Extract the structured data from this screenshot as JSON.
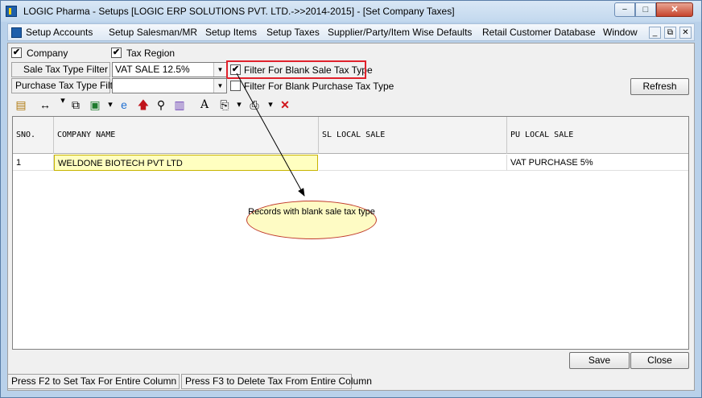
{
  "window": {
    "title": "LOGIC Pharma - Setups  [LOGIC ERP SOLUTIONS PVT. LTD.->>2014-2015] - [Set Company Taxes]",
    "min_label": "−",
    "max_label": "□",
    "close_label": "✕"
  },
  "menu": {
    "items": [
      "Setup Accounts",
      "Setup Salesman/MR",
      "Setup Items",
      "Setup Taxes",
      "Supplier/Party/Item Wise Defaults",
      "Retail Customer Database",
      "Window"
    ],
    "mdi_min": "_",
    "mdi_restore": "⧉",
    "mdi_close": "✕"
  },
  "filters": {
    "company": {
      "label": "Company",
      "checked": true
    },
    "tax_region": {
      "label": "Tax Region",
      "checked": true
    },
    "sale_tax_type_label": "Sale Tax Type Filter",
    "sale_tax_type_value": "VAT SALE 12.5%",
    "purchase_tax_type_label": "Purchase Tax Type Filter",
    "purchase_tax_type_value": "",
    "blank_sale": {
      "label": "Filter For Blank Sale Tax Type",
      "checked": true
    },
    "blank_purchase": {
      "label": "Filter For Blank Purchase Tax Type",
      "checked": false
    },
    "refresh_label": "Refresh"
  },
  "toolbar": {
    "icons": [
      "layout-icon",
      "resize-columns-icon",
      "copy-icon",
      "excel-icon",
      "dropdown-arrow-icon",
      "internet-explorer-icon",
      "up-arrow-icon",
      "binoculars-icon",
      "bar-chart-icon",
      "font-icon",
      "print-preview-icon",
      "dropdown-arrow-icon",
      "printer-icon",
      "dropdown-arrow-icon",
      "delete-icon"
    ]
  },
  "grid": {
    "columns": [
      "SNO.",
      "COMPANY NAME",
      "SL LOCAL SALE",
      "PU LOCAL SALE"
    ],
    "rows": [
      {
        "sno": "1",
        "company": "WELDONE BIOTECH PVT LTD",
        "sl_local_sale": "",
        "pu_local_sale": "VAT PURCHASE 5%"
      }
    ]
  },
  "annotation": {
    "text": "Records with blank sale tax type",
    "border_color": "#c0392b",
    "highlight_color": "#e0212b"
  },
  "buttons": {
    "save": "Save",
    "close": "Close"
  },
  "status": {
    "f2": "Press F2 to Set Tax For Entire Column",
    "f3": "Press F3 to Delete Tax From Entire Column"
  }
}
